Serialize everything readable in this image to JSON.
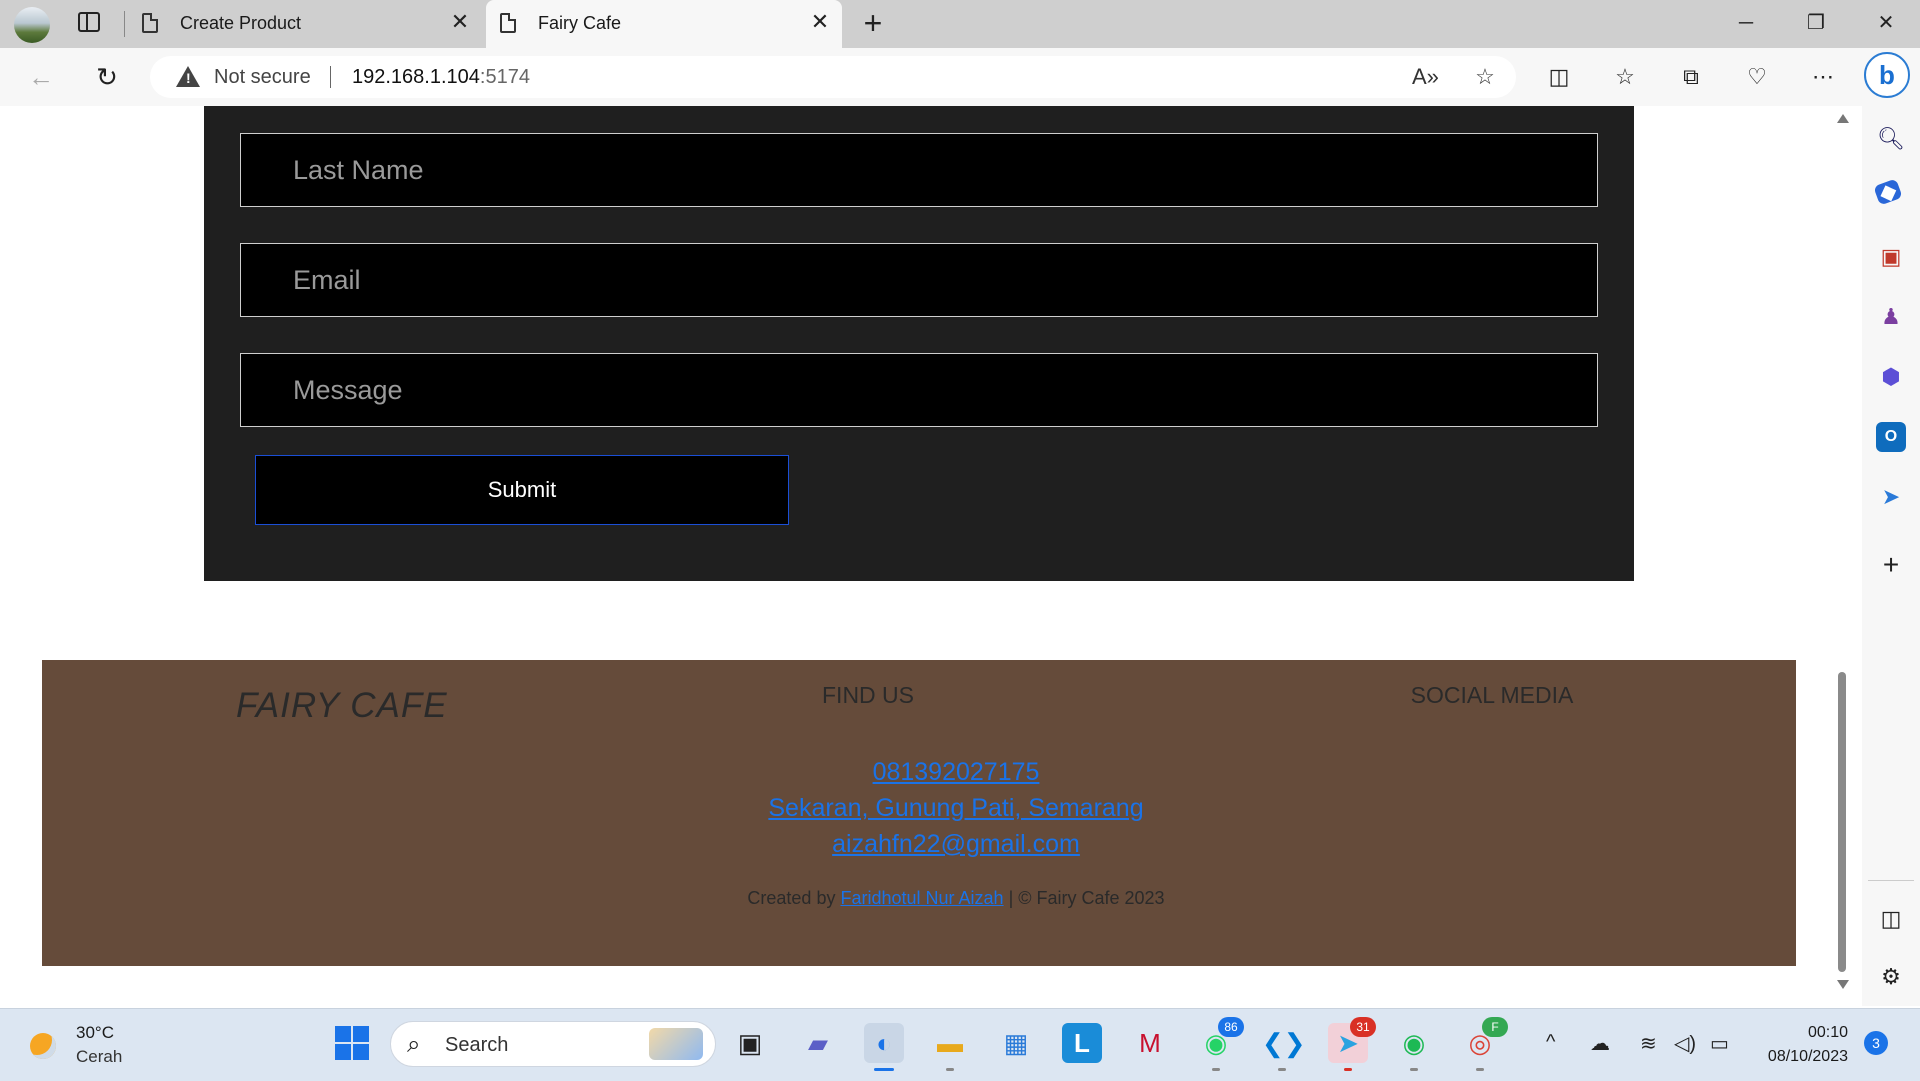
{
  "browser": {
    "tabs": [
      {
        "title": "Create Product",
        "active": false
      },
      {
        "title": "Fairy Cafe",
        "active": true
      }
    ],
    "address": {
      "security_label": "Not secure",
      "host": "192.168.1.104",
      "port": ":5174"
    }
  },
  "page": {
    "form": {
      "last_name_placeholder": "Last Name",
      "email_placeholder": "Email",
      "message_placeholder": "Message",
      "submit_label": "Submit"
    },
    "footer": {
      "brand": "FAIRY CAFE",
      "find_us_heading": "FIND US",
      "social_heading": "SOCIAL MEDIA",
      "phone": "081392027175",
      "address": "Sekaran, Gunung Pati, Semarang",
      "email": "aizahfn22@gmail.com",
      "credit_prefix": "Created by ",
      "credit_author": "Faridhotul Nur Aizah",
      "credit_suffix": " | © Fairy Cafe 2023"
    }
  },
  "taskbar": {
    "weather_temp": "30°C",
    "weather_condition": "Cerah",
    "search_label": "Search",
    "whatsapp_badge": "86",
    "telegram_badge": "31",
    "chrome_profile_letter": "F",
    "time": "00:10",
    "date": "08/10/2023",
    "notification_count": "3"
  },
  "colors": {
    "form_bg": "#1f1f1f",
    "footer_bg": "#654b3a",
    "link": "#1a73e8",
    "submit_border": "#1b4fd6"
  }
}
